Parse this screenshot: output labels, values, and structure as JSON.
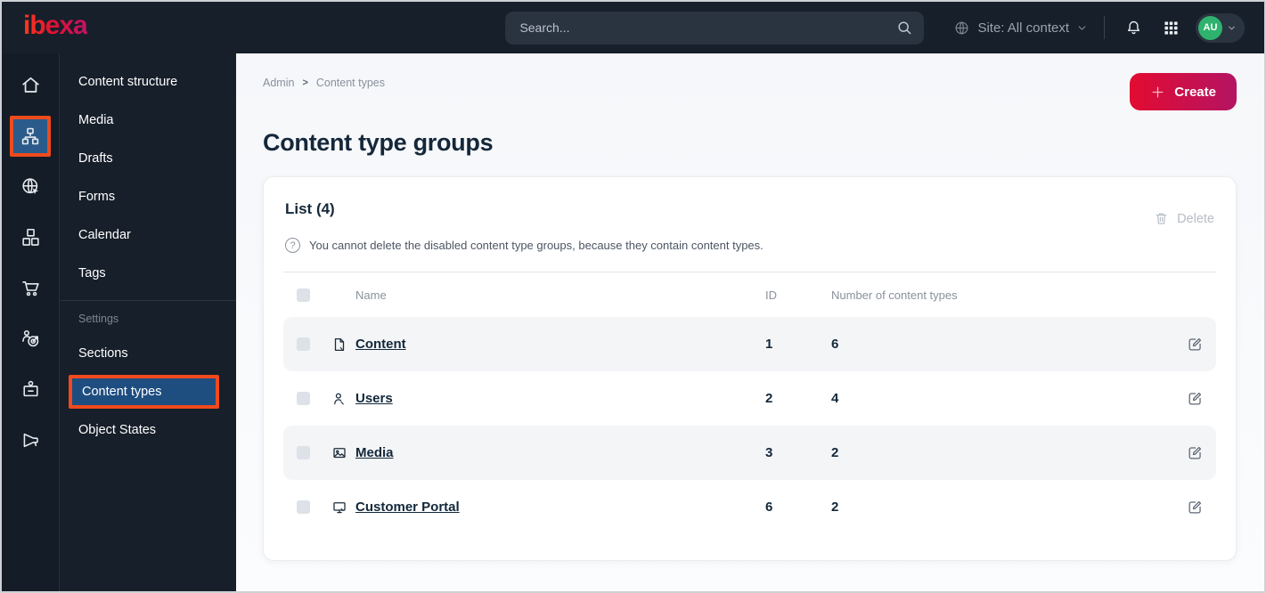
{
  "topbar": {
    "logo": "ibexa",
    "search_placeholder": "Search...",
    "site_selector_label": "Site: All context",
    "avatar_initials": "AU"
  },
  "icon_rail": {
    "items": [
      {
        "icon": "home-icon",
        "active": false
      },
      {
        "icon": "content-structure-icon",
        "active": true
      },
      {
        "icon": "site-globe-icon",
        "active": false
      },
      {
        "icon": "product-catalog-icon",
        "active": false
      },
      {
        "icon": "commerce-cart-icon",
        "active": false
      },
      {
        "icon": "personalization-target-icon",
        "active": false
      },
      {
        "icon": "id-badge-icon",
        "active": false
      },
      {
        "icon": "megaphone-icon",
        "active": false
      }
    ]
  },
  "sidebar": {
    "items": [
      "Content structure",
      "Media",
      "Drafts",
      "Forms",
      "Calendar",
      "Tags"
    ],
    "settings_label": "Settings",
    "settings_items": [
      "Sections",
      "Content types",
      "Object States"
    ],
    "active_item": "Content types"
  },
  "breadcrumb": {
    "items": [
      "Admin",
      "Content types"
    ],
    "separator": ">"
  },
  "page": {
    "title": "Content type groups",
    "create_label": "Create"
  },
  "list_card": {
    "title": "List (4)",
    "help_icon": "?",
    "help_text": "You cannot delete the disabled content type groups, because they contain content types.",
    "delete_label": "Delete",
    "table": {
      "columns": {
        "name": "Name",
        "id": "ID",
        "count": "Number of content types"
      },
      "rows": [
        {
          "name": "Content",
          "id": "1",
          "count": "6",
          "icon": "file-icon"
        },
        {
          "name": "Users",
          "id": "2",
          "count": "4",
          "icon": "user-icon"
        },
        {
          "name": "Media",
          "id": "3",
          "count": "2",
          "icon": "image-icon"
        },
        {
          "name": "Customer Portal",
          "id": "6",
          "count": "2",
          "icon": "monitor-icon"
        }
      ]
    }
  },
  "colors": {
    "topbar_bg": "#161f2a",
    "annotation_orange": "#f04a1d",
    "active_blue": "#2b5b8a",
    "brand_gradient_start": "#e30b31",
    "brand_gradient_end": "#b41463",
    "avatar_green": "#2fb26e",
    "row_shade": "#f4f5f7"
  }
}
